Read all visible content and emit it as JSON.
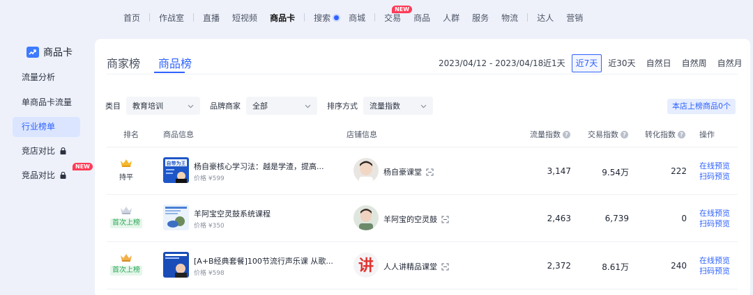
{
  "topnav": {
    "items": [
      "首页",
      "作战室",
      "直播",
      "短视频",
      "商品卡",
      "搜索",
      "商城",
      "交易",
      "商品",
      "人群",
      "服务",
      "物流",
      "达人",
      "营销"
    ],
    "new_badge": "NEW"
  },
  "sidebar": {
    "brand": "商品卡",
    "items": [
      {
        "label": "流量分析"
      },
      {
        "label": "单商品卡流量"
      },
      {
        "label": "行业榜单"
      },
      {
        "label": "竞店对比"
      },
      {
        "label": "竞品对比"
      }
    ],
    "new_badge": "NEW"
  },
  "tabs": {
    "merchant": "商家榜",
    "product": "商品榜"
  },
  "date_range": "2023/04/12 - 2023/04/18",
  "periods": [
    "近1天",
    "近7天",
    "近30天",
    "自然日",
    "自然周",
    "自然月"
  ],
  "filters": {
    "category_label": "类目",
    "category_value": "教育培训",
    "brand_label": "品牌商家",
    "brand_value": "全部",
    "sort_label": "排序方式",
    "sort_value": "流量指数"
  },
  "store_button": "本店上榜商品0个",
  "table": {
    "headers": {
      "rank": "排名",
      "product": "商品信息",
      "shop": "店铺信息",
      "traffic": "流量指数",
      "trade": "交易指数",
      "conversion": "转化指数",
      "action": "操作"
    },
    "rows": [
      {
        "rank_status": "持平",
        "thumb_text": "自带为王",
        "title": "杨自豪核心学习法：越是学渣，提高...",
        "price": "价格 ¥599",
        "shop": "杨自豪课堂",
        "traffic": "3,147",
        "trade": "9.54万",
        "conversion": "222",
        "op_preview": "在线预览",
        "op_scan": "扫码预览"
      },
      {
        "rank_status": "首次上榜",
        "title": "羊阿宝空灵鼓系统课程",
        "price": "价格 ¥350",
        "shop": "羊阿宝的空灵鼓",
        "traffic": "2,463",
        "trade": "6,739",
        "conversion": "0",
        "op_preview": "在线预览",
        "op_scan": "扫码预览"
      },
      {
        "rank_status": "首次上榜",
        "title": "[A+B经典套餐]100节流行声乐课 从歌...",
        "price": "价格 ¥598",
        "shop": "人人讲精品课堂",
        "shop_logo_text": "讲",
        "traffic": "2,372",
        "trade": "8.61万",
        "conversion": "240",
        "op_preview": "在线预览",
        "op_scan": "扫码预览"
      }
    ]
  }
}
